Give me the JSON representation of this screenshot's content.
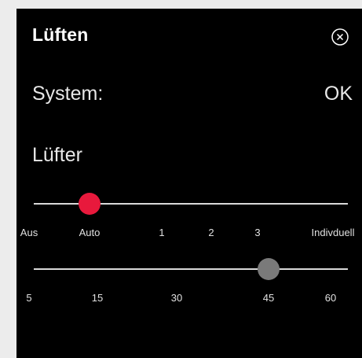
{
  "dialog": {
    "title": "Lüften",
    "close_icon": "circle-x-icon"
  },
  "system": {
    "label": "System:",
    "value": "OK"
  },
  "fan": {
    "label": "Lüfter",
    "mode_slider": {
      "ticks": [
        "Aus",
        "Auto",
        "1",
        "2",
        "3",
        "Indivduell"
      ],
      "selected": "Auto",
      "thumb_color": "#e8193c"
    },
    "time_slider": {
      "ticks": [
        "5",
        "15",
        "30",
        "45",
        "60"
      ],
      "selected": "45",
      "thumb_color": "#7a7a7a"
    }
  },
  "colors": {
    "background": "#000000",
    "text": "#ffffff",
    "track": "#d9d9d9"
  }
}
